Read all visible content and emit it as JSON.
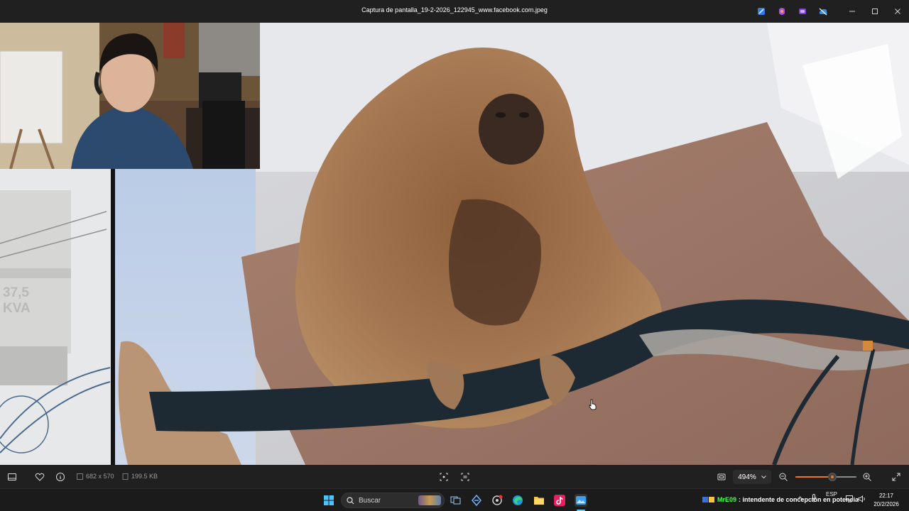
{
  "window": {
    "title": "Captura de pantalla_19-2-2026_122945_www.facebook.com.jpeg",
    "controls": [
      "minimize",
      "maximize",
      "close"
    ]
  },
  "titlebar_app_icons": [
    "designer-icon",
    "copilot-icon",
    "clipchamp-icon",
    "onedrive-icon"
  ],
  "photo": {
    "inset_label_line1": "37,5",
    "inset_label_line2": "KVA",
    "subject": "howler-monkey-on-cables"
  },
  "toolbar": {
    "dimensions": "682 x 570",
    "file_size": "199.5 KB",
    "zoom": "494%",
    "zoom_level_fraction": 0.6,
    "accent_color": "#e37a2a"
  },
  "taskbar": {
    "search_placeholder": "Buscar",
    "news_user": "MrE09",
    "news_text": ": intendente de concepción en potencia",
    "language": "ESP",
    "time": "22:17",
    "date": "20/2/2026"
  }
}
